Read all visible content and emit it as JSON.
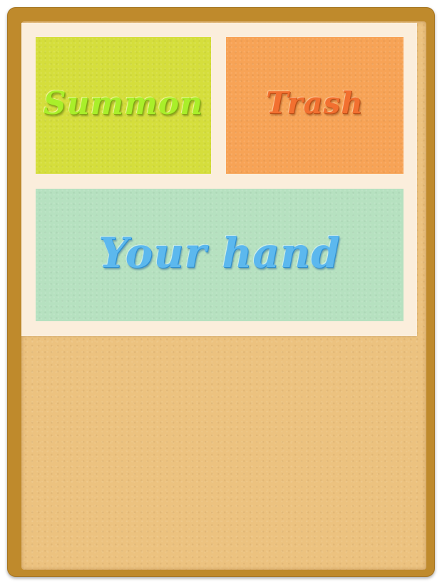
{
  "zones": {
    "summon": {
      "label": "Summon",
      "color": "#d5de3c",
      "text_color": "#a9ef2a"
    },
    "trash": {
      "label": "Trash",
      "color": "#f7a356",
      "text_color": "#f27030"
    },
    "hand": {
      "label": "Your hand",
      "color": "#b6e1c0",
      "text_color": "#5cb8ee"
    }
  },
  "board": {
    "frame_color": "#bf8a2c",
    "cork_color": "#ecc27f",
    "mat_color": "#fbeedc"
  }
}
